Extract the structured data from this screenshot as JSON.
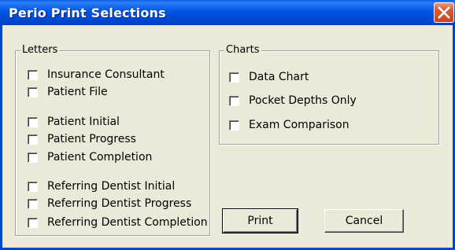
{
  "window": {
    "title": "Perio Print Selections",
    "close_icon": "close-icon"
  },
  "letters": {
    "label": "Letters",
    "items": [
      {
        "label": "Insurance Consultant",
        "checked": false
      },
      {
        "label": "Patient File",
        "checked": false
      },
      {
        "label": "Patient Initial",
        "checked": false
      },
      {
        "label": "Patient Progress",
        "checked": false
      },
      {
        "label": "Patient Completion",
        "checked": false
      },
      {
        "label": "Referring Dentist Initial",
        "checked": false
      },
      {
        "label": "Referring Dentist Progress",
        "checked": false
      },
      {
        "label": "Referring Dentist Completion",
        "checked": false
      }
    ]
  },
  "charts": {
    "label": "Charts",
    "items": [
      {
        "label": "Data Chart",
        "checked": false
      },
      {
        "label": "Pocket Depths Only",
        "checked": false
      },
      {
        "label": "Exam Comparison",
        "checked": false
      }
    ]
  },
  "buttons": {
    "print": "Print",
    "cancel": "Cancel"
  }
}
